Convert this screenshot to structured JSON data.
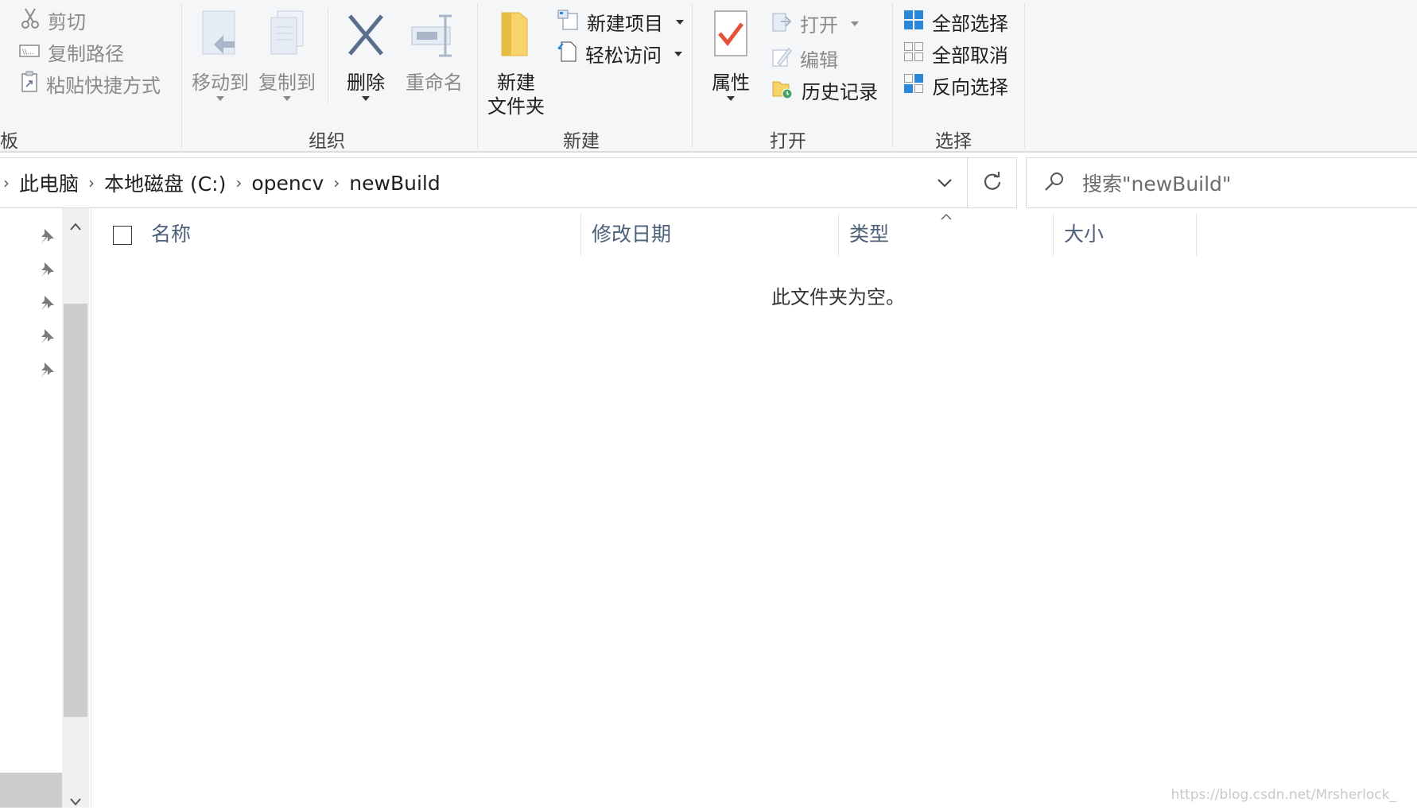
{
  "ribbon": {
    "clipboard": {
      "cut": "剪切",
      "copy_path": "复制路径",
      "paste_shortcut": "粘贴快捷方式",
      "group_label_partial": "板"
    },
    "organize": {
      "move_to": "移动到",
      "copy_to": "复制到",
      "delete": "删除",
      "rename": "重命名",
      "group_label": "组织"
    },
    "new": {
      "new_folder_line1": "新建",
      "new_folder_line2": "文件夹",
      "new_item": "新建项目",
      "easy_access": "轻松访问",
      "group_label": "新建"
    },
    "open": {
      "properties": "属性",
      "open": "打开",
      "edit": "编辑",
      "history": "历史记录",
      "group_label": "打开"
    },
    "select": {
      "select_all": "全部选择",
      "select_none": "全部取消",
      "invert_selection": "反向选择",
      "group_label": "选择"
    }
  },
  "address": {
    "crumbs": [
      "此电脑",
      "本地磁盘 (C:)",
      "opencv",
      "newBuild"
    ]
  },
  "search": {
    "placeholder": "搜索\"newBuild\""
  },
  "columns": {
    "name": "名称",
    "modified": "修改日期",
    "type": "类型",
    "size": "大小"
  },
  "content": {
    "empty_message": "此文件夹为空。"
  },
  "watermark": "https://blog.csdn.net/Mrsherlock_",
  "colors": {
    "ribbon_bg": "#f5f6f7",
    "column_header_text": "#4c607a",
    "folder_yellow": "#f7d36b",
    "accent_blue": "#2b88d8",
    "check_red": "#e2533a"
  }
}
